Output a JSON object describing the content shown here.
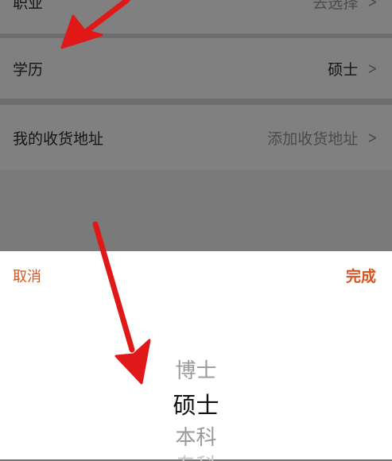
{
  "rows": {
    "occupation": {
      "label": "职业",
      "value": "去选择"
    },
    "education": {
      "label": "学历",
      "value": "硕士"
    },
    "address": {
      "label": "我的收货地址",
      "value": "添加收货地址"
    }
  },
  "chevron": ">",
  "sheet": {
    "cancel_label": "取消",
    "done_label": "完成",
    "options": [
      "博士",
      "硕士",
      "本科",
      "专科"
    ],
    "selected": "硕士"
  },
  "colors": {
    "accent": "#d9531e",
    "annotation_arrow": "#e01818"
  }
}
